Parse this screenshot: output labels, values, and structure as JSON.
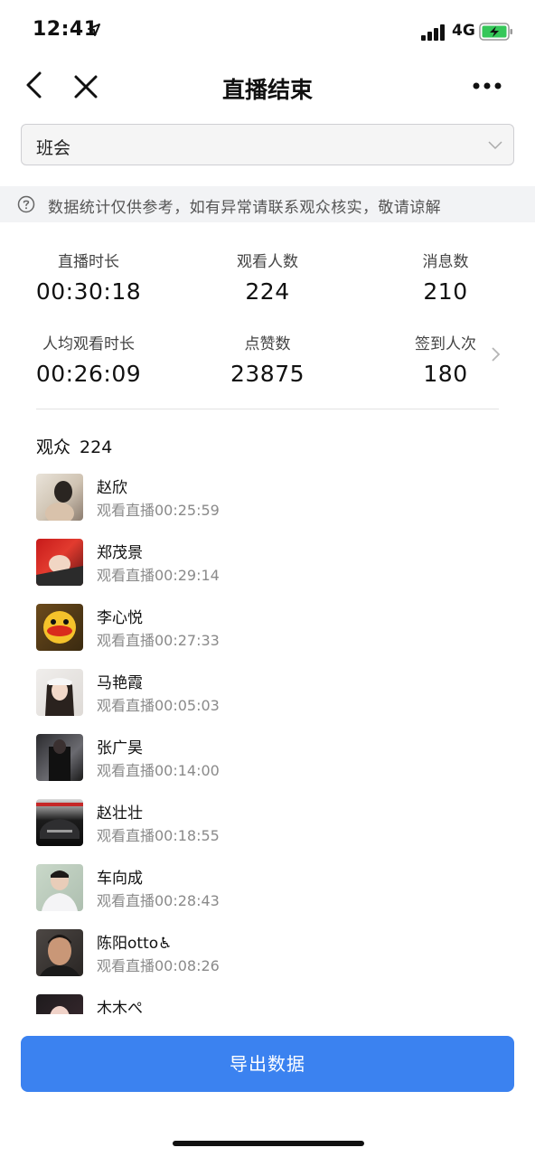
{
  "status_bar": {
    "time": "12:41",
    "network": "4G"
  },
  "nav": {
    "title": "直播结束"
  },
  "select": {
    "value": "班会"
  },
  "notice": {
    "text": "数据统计仅供参考，如有异常请联系观众核实，敬请谅解"
  },
  "stats": [
    {
      "label": "直播时长",
      "value": "00:30:18"
    },
    {
      "label": "观看人数",
      "value": "224"
    },
    {
      "label": "消息数",
      "value": "210"
    },
    {
      "label": "人均观看时长",
      "value": "00:26:09"
    },
    {
      "label": "点赞数",
      "value": "23875"
    },
    {
      "label": "签到人次",
      "value": "180"
    }
  ],
  "audience": {
    "title": "观众",
    "count": "224",
    "viewers": [
      {
        "name": "赵欣",
        "time": "观看直播00:25:59"
      },
      {
        "name": "郑茂景",
        "time": "观看直播00:29:14"
      },
      {
        "name": "李心悦",
        "time": "观看直播00:27:33"
      },
      {
        "name": "马艳霞",
        "time": "观看直播00:05:03"
      },
      {
        "name": "张广昊",
        "time": "观看直播00:14:00"
      },
      {
        "name": "赵壮壮",
        "time": "观看直播00:18:55"
      },
      {
        "name": "车向成",
        "time": "观看直播00:28:43"
      },
      {
        "name": "陈阳otto♿",
        "time": "观看直播00:08:26"
      },
      {
        "name": "木木ぺ",
        "time": ""
      }
    ]
  },
  "export_button": {
    "label": "导出数据"
  },
  "colors": {
    "accent": "#3b82f0",
    "battery": "#35c759"
  }
}
